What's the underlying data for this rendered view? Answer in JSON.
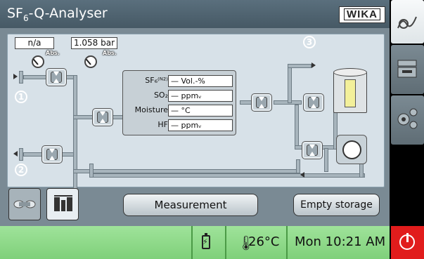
{
  "header": {
    "title_main": "SF",
    "title_sub": "6",
    "title_rest": "-Q-Analyser",
    "logo_text": "WIKA"
  },
  "inlet": {
    "pressure_left": "n/a",
    "pressure_right": "1.058 bar",
    "abs_left": "Abs.",
    "abs_right": "Abs.",
    "port1": "1",
    "port2": "2",
    "port3": "3"
  },
  "sensors": {
    "rows": [
      {
        "label": "SF₆⁽ᴺ²⁾",
        "value": "— Vol.-%"
      },
      {
        "label": "SO₂",
        "value": "— ppmᵥ"
      },
      {
        "label": "Moisture",
        "value": "— °C"
      },
      {
        "label": "HF",
        "value": "— ppmᵥ"
      }
    ]
  },
  "controls": {
    "measurement_label": "Measurement",
    "empty_storage_label": "Empty storage"
  },
  "status": {
    "temperature": "26°C",
    "clock": "Mon 10:21 AM"
  },
  "colors": {
    "status_green": "#8fd98a",
    "power_red": "#e11c1c",
    "tank_level": "#f3f09a"
  }
}
